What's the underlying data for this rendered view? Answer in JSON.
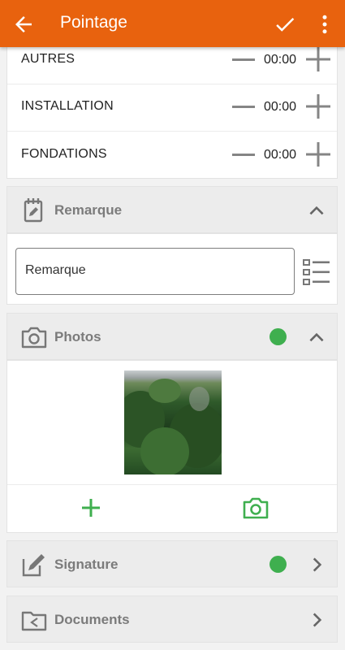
{
  "header": {
    "title": "Pointage",
    "back_icon": "arrow-back-icon",
    "confirm_icon": "check-icon",
    "menu_icon": "more-vert-icon",
    "color": "#e8620e"
  },
  "times": [
    {
      "label": "AUTRES",
      "value": "00:00"
    },
    {
      "label": "INSTALLATION",
      "value": "00:00"
    },
    {
      "label": "FONDATIONS",
      "value": "00:00"
    }
  ],
  "remarque": {
    "title": "Remarque",
    "placeholder": "Remarque",
    "icon": "notepad-icon",
    "list_icon": "checklist-icon"
  },
  "photos": {
    "title": "Photos",
    "icon": "camera-icon",
    "status_color": "#3faf4f",
    "add_icon": "add-icon",
    "camera_action_icon": "camera-icon"
  },
  "signature": {
    "title": "Signature",
    "icon": "pen-icon",
    "status_color": "#3faf4f"
  },
  "documents": {
    "title": "Documents",
    "icon": "folder-share-icon"
  }
}
